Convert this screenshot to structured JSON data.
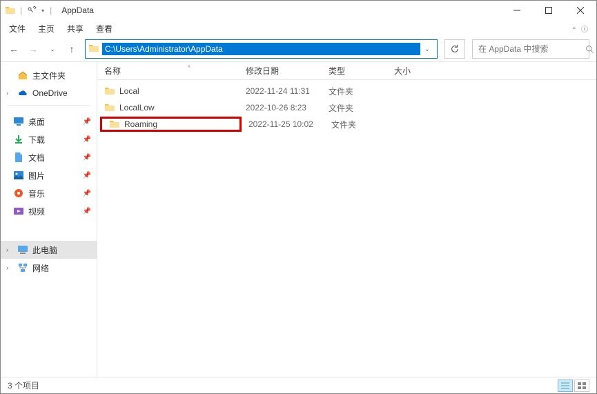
{
  "title": "AppData",
  "menu": {
    "file": "文件",
    "home": "主页",
    "share": "共享",
    "view": "查看"
  },
  "address": {
    "path": "C:\\Users\\Administrator\\AppData"
  },
  "search": {
    "placeholder": "在 AppData 中搜索"
  },
  "sidebar": {
    "home": "主文件夹",
    "onedrive": "OneDrive",
    "quick": {
      "desktop": "桌面",
      "downloads": "下载",
      "documents": "文档",
      "pictures": "图片",
      "music": "音乐",
      "videos": "视频"
    },
    "thispc": "此电脑",
    "network": "网络"
  },
  "columns": {
    "name": "名称",
    "date": "修改日期",
    "type": "类型",
    "size": "大小"
  },
  "files": [
    {
      "name": "Local",
      "date": "2022-11-24 11:31",
      "type": "文件夹"
    },
    {
      "name": "LocalLow",
      "date": "2022-10-26 8:23",
      "type": "文件夹"
    },
    {
      "name": "Roaming",
      "date": "2022-11-25 10:02",
      "type": "文件夹"
    }
  ],
  "status": {
    "count": "3 个项目"
  }
}
